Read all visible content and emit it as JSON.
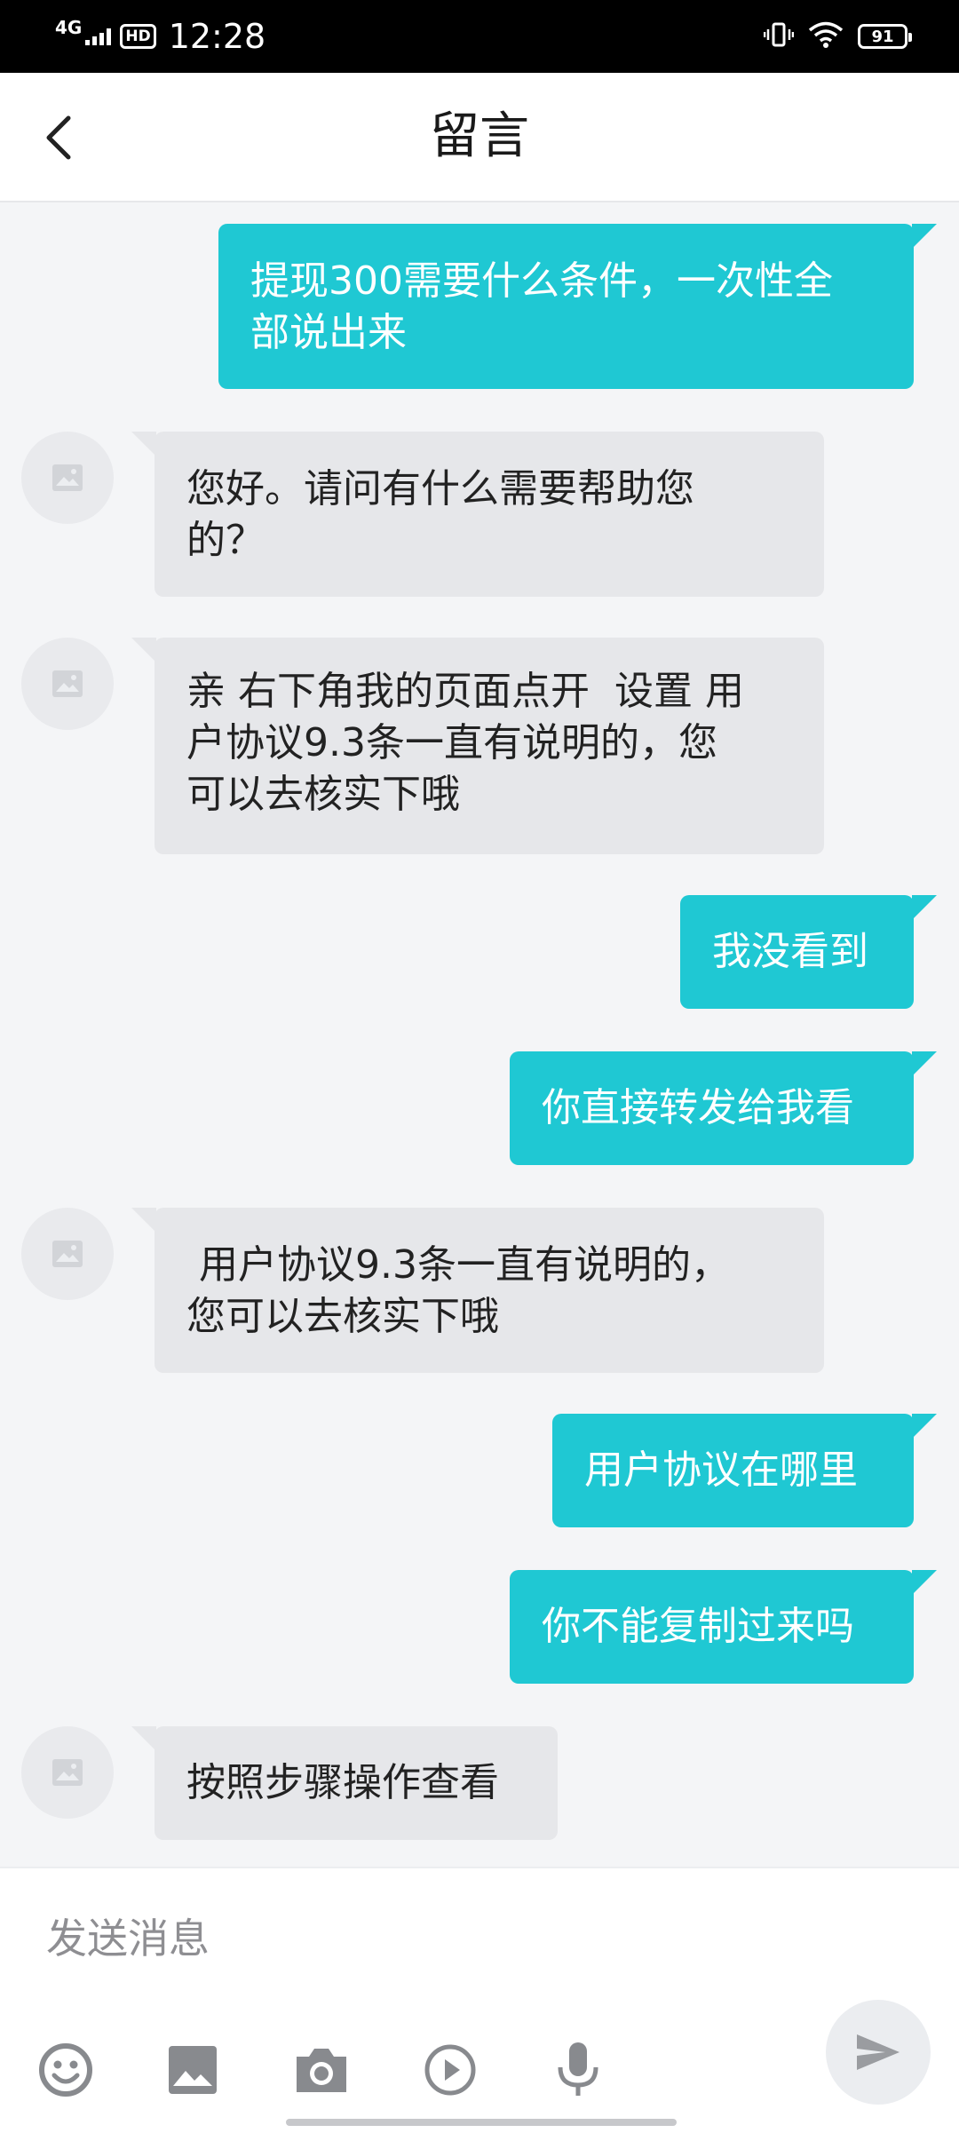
{
  "status_bar": {
    "network": "4G",
    "hd_badge": "HD",
    "time": "12:28",
    "battery": "91"
  },
  "header": {
    "title": "留言",
    "back_icon": "chevron-left-icon"
  },
  "messages": [
    {
      "direction": "outgoing",
      "lines": [
        "提现300需要什么条件，一次性全",
        "部说出来"
      ]
    },
    {
      "direction": "incoming",
      "lines": [
        "您好。请问有什么需要帮助您",
        "的？"
      ]
    },
    {
      "direction": "incoming",
      "lines": [
        "亲 右下角我的页面点开  设置 用",
        "户协议9.3条一直有说明的，您",
        "可以去核实下哦"
      ]
    },
    {
      "direction": "outgoing",
      "lines": [
        "我没看到"
      ]
    },
    {
      "direction": "outgoing",
      "lines": [
        "你直接转发给我看"
      ]
    },
    {
      "direction": "incoming",
      "lines": [
        " 用户协议9.3条一直有说明的，",
        "您可以去核实下哦"
      ]
    },
    {
      "direction": "outgoing",
      "lines": [
        "用户协议在哪里"
      ]
    },
    {
      "direction": "outgoing",
      "lines": [
        "你不能复制过来吗"
      ]
    },
    {
      "direction": "incoming",
      "lines": [
        "按照步骤操作查看"
      ]
    }
  ],
  "composer": {
    "placeholder": "发送消息",
    "tools": [
      "emoji-icon",
      "image-icon",
      "camera-icon",
      "video-icon",
      "microphone-icon"
    ],
    "send_icon": "send-icon"
  },
  "colors": {
    "outgoing_bubble": "#1fc8d3",
    "incoming_bubble": "#e6e7ea",
    "background": "#f4f5f7"
  }
}
